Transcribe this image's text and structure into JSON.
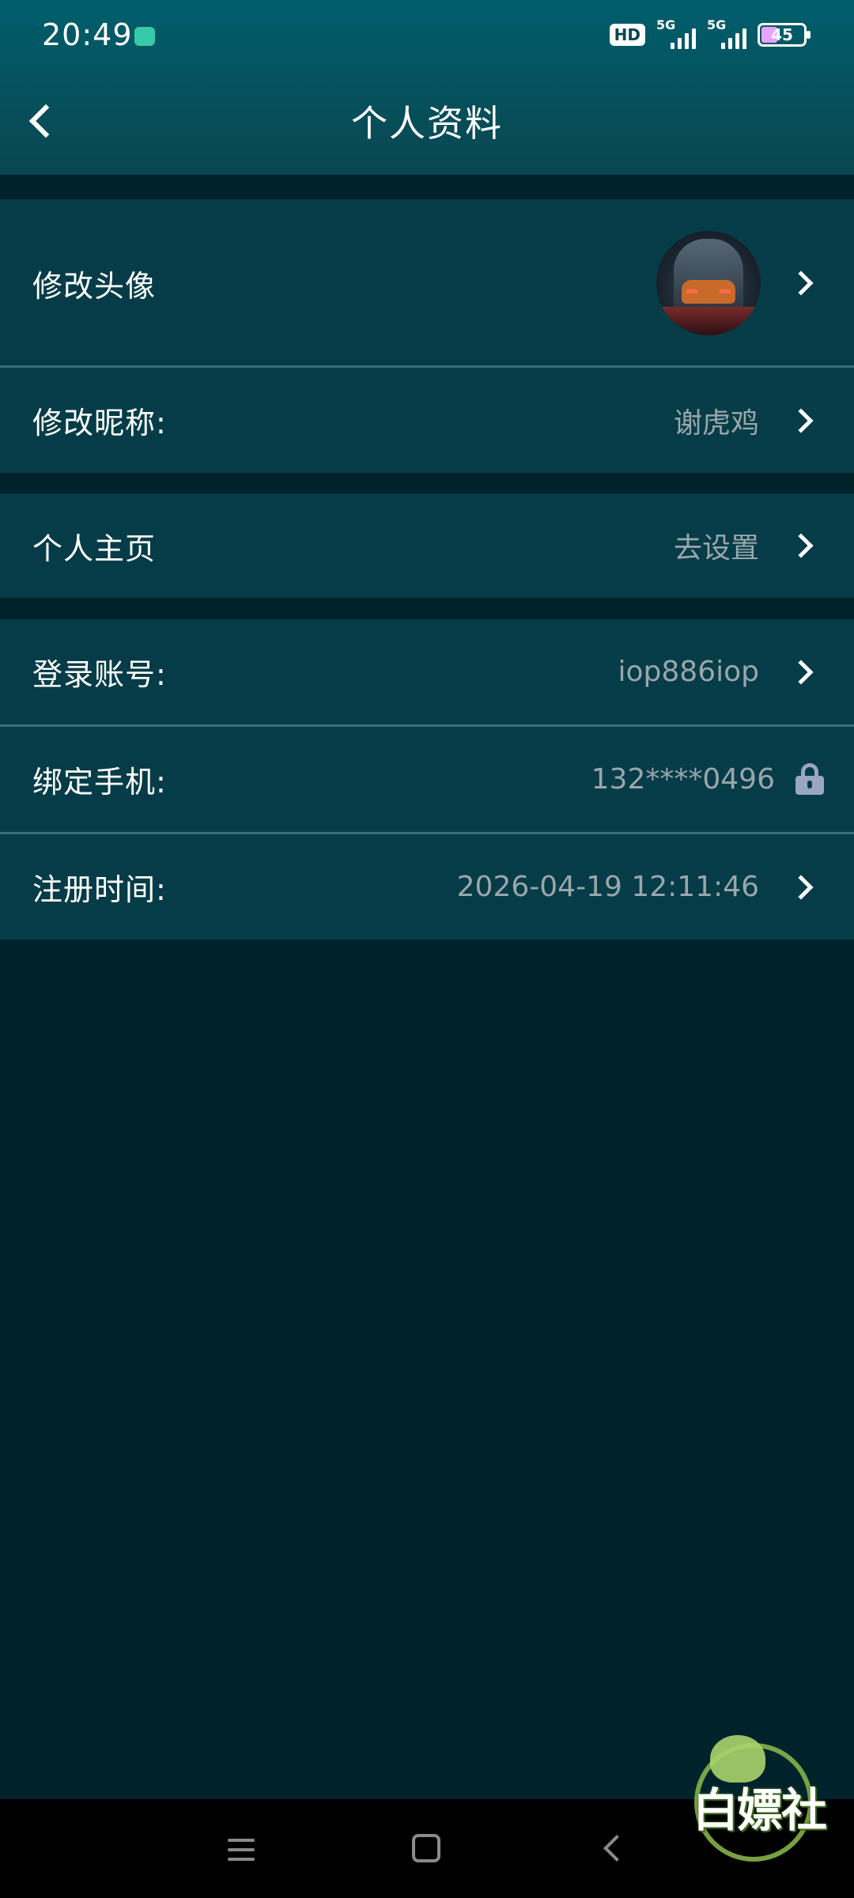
{
  "status_bar": {
    "time": "20:49",
    "hd_label": "HD",
    "signal1_label": "5G",
    "signal2_label": "5G",
    "battery_level": "45"
  },
  "header": {
    "title": "个人资料"
  },
  "rows": {
    "avatar": {
      "label": "修改头像"
    },
    "nickname": {
      "label": "修改昵称:",
      "value": "谢虎鸡"
    },
    "homepage": {
      "label": "个人主页",
      "value": "去设置"
    },
    "account": {
      "label": "登录账号:",
      "value": "iop886iop"
    },
    "phone": {
      "label": "绑定手机:",
      "value": "132****0496"
    },
    "register_time": {
      "label": "注册时间:",
      "value": "2026-04-19 12:11:46"
    }
  },
  "watermark": {
    "text": "白嫖社"
  },
  "colors": {
    "header_top": "#005e6c",
    "row_bg": "#053c47",
    "page_bg": "#00222b",
    "value_text": "#9aa6ab",
    "lock": "#9aa6c2"
  },
  "icons": {
    "back": "back-arrow-icon",
    "chevron": "chevron-right-icon",
    "lock": "lock-icon"
  }
}
